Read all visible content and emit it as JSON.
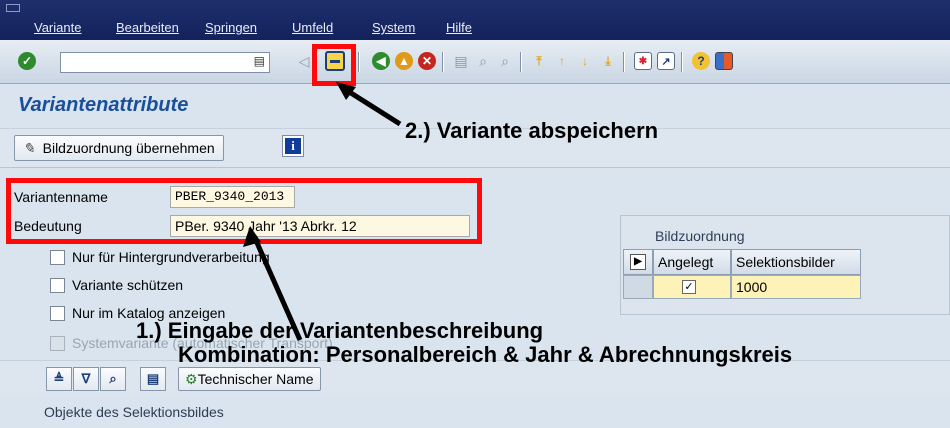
{
  "menu": {
    "items": [
      "Variante",
      "Bearbeiten",
      "Springen",
      "Umfeld",
      "System",
      "Hilfe"
    ]
  },
  "toolbar": {
    "command_field_value": "",
    "command_icon": "clipboard-icon"
  },
  "page": {
    "title": "Variantenattribute"
  },
  "appbar": {
    "button_label": "Bildzuordnung übernehmen",
    "info_glyph": "i"
  },
  "form": {
    "variantenname_label": "Variantenname",
    "variantenname_value": "PBER_9340_2013",
    "bedeutung_label": "Bedeutung",
    "bedeutung_value": "PBer. 9340 Jahr '13 Abrkr. 12",
    "checkboxes": [
      {
        "label": "Nur für Hintergrundverarbeitung",
        "checked": false,
        "enabled": true
      },
      {
        "label": "Variante schützen",
        "checked": false,
        "enabled": true
      },
      {
        "label": "Nur im Katalog anzeigen",
        "checked": false,
        "enabled": true
      },
      {
        "label": "Systemvariante (automatischer Transport)",
        "checked": false,
        "enabled": false
      }
    ]
  },
  "bildzuordnung": {
    "title": "Bildzuordnung",
    "columns": [
      "Angelegt",
      "Selektionsbilder"
    ],
    "rows": [
      {
        "angelegt": true,
        "selektionsbild": "1000"
      }
    ]
  },
  "bottom": {
    "technischer_name_label": "Technischer Name",
    "objects_label": "Objekte des Selektionsbildes"
  },
  "annotations": {
    "step2": "2.) Variante abspeichern",
    "step1_line1": "1.) Eingabe der Variantenbeschreibung",
    "step1_line2": "Kombination: Personalbereich & Jahr & Abrechnungskreis"
  },
  "colors": {
    "highlight": "#ff0a0a",
    "title": "#1a4f9a",
    "menubar": "#1a2a66",
    "field_bg": "#fdf8e1"
  }
}
